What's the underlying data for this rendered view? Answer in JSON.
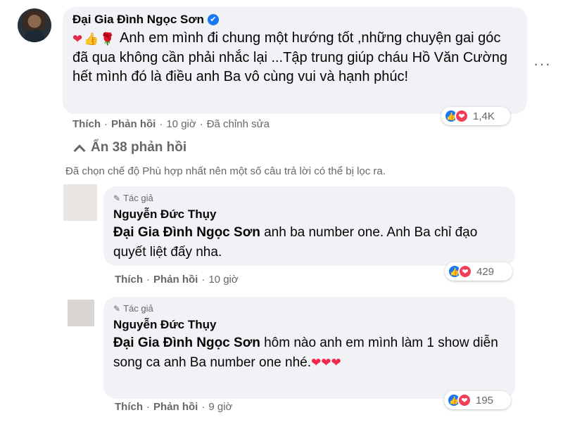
{
  "comment": {
    "author": "Đại Gia Đình Ngọc Sơn",
    "emojis": [
      "❤",
      "👍",
      "🌹"
    ],
    "text": "Anh em mình đi chung một hướng tốt ,những chuyện gai góc đã qua không cần phải nhắc lại ...Tập trung giúp cháu Hồ Văn Cường hết mình đó là điều anh Ba vô cùng vui và hạnh phúc!",
    "actions": {
      "like": "Thích",
      "reply": "Phản hồi",
      "time": "10 giờ",
      "edited": "Đã chỉnh sửa"
    },
    "reaction_count": "1,4K"
  },
  "more_menu": "···",
  "hide_replies_label": "Ẩn 38 phản hồi",
  "filter_notice": "Đã chọn chế độ Phù hợp nhất nên một số câu trả lời có thể bị lọc ra.",
  "replies": [
    {
      "tag": "Tác giả",
      "author": "Nguyễn Đức Thụy",
      "mention": "Đại Gia Đình Ngọc Sơn",
      "text": " anh ba number one. Anh Ba chỉ đạo quyết liệt đấy nha.",
      "hearts": "",
      "actions": {
        "like": "Thích",
        "reply": "Phản hồi",
        "time": "10 giờ"
      },
      "reaction_count": "429"
    },
    {
      "tag": "Tác giả",
      "author": "Nguyễn Đức Thụy",
      "mention": "Đại Gia Đình Ngọc Sơn",
      "text": " hôm nào anh em mình làm 1 show diễn song ca anh Ba number one nhé.",
      "hearts": "❤❤❤",
      "actions": {
        "like": "Thích",
        "reply": "Phản hồi",
        "time": "9 giờ"
      },
      "reaction_count": "195"
    }
  ],
  "icons": {
    "verified": "✔",
    "like": "👍",
    "heart": "❤",
    "pencil": "✎"
  },
  "colors": {
    "bubble": "#f0f2f5",
    "secondary_text": "#65676b",
    "like_blue": "#1877f2",
    "love_red": "#f33e58"
  }
}
